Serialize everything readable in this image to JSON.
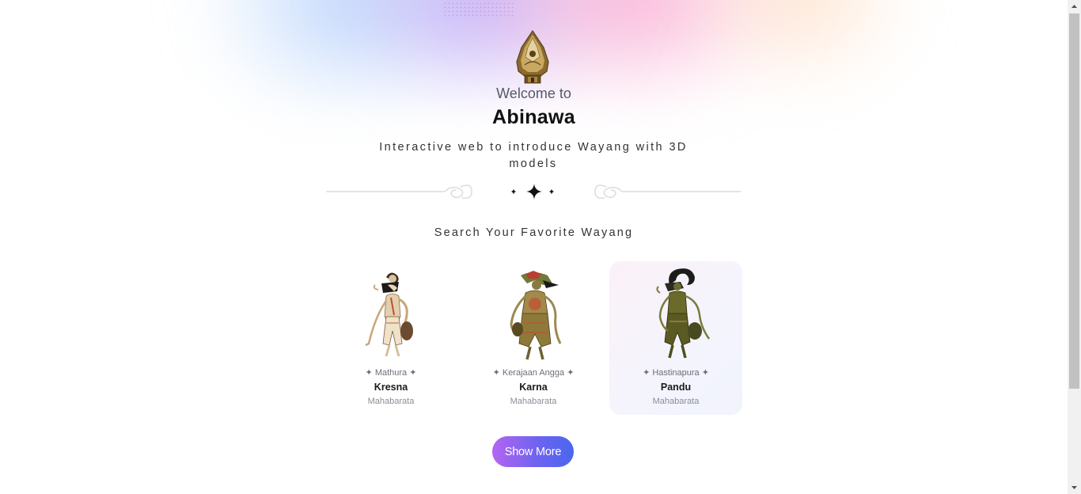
{
  "header": {
    "welcome": "Welcome to",
    "brand": "Abinawa",
    "subtitle": "Interactive web to introduce Wayang with 3D models"
  },
  "search": {
    "title": "Search Your Favorite Wayang"
  },
  "cards": [
    {
      "origin": "✦ Mathura ✦",
      "name": "Kresna",
      "epic": "Mahabarata",
      "active": false
    },
    {
      "origin": "✦ Kerajaan Angga ✦",
      "name": "Karna",
      "epic": "Mahabarata",
      "active": false
    },
    {
      "origin": "✦ Hastinapura ✦",
      "name": "Pandu",
      "epic": "Mahabarata",
      "active": true
    }
  ],
  "actions": {
    "show_more": "Show More"
  },
  "icons": {
    "logo": "gunungan-logo-icon",
    "divider": "ornament-divider-icon"
  },
  "colors": {
    "button_start": "#b465f1",
    "button_end": "#4a66ef",
    "active_card": "#f4f4fd"
  }
}
